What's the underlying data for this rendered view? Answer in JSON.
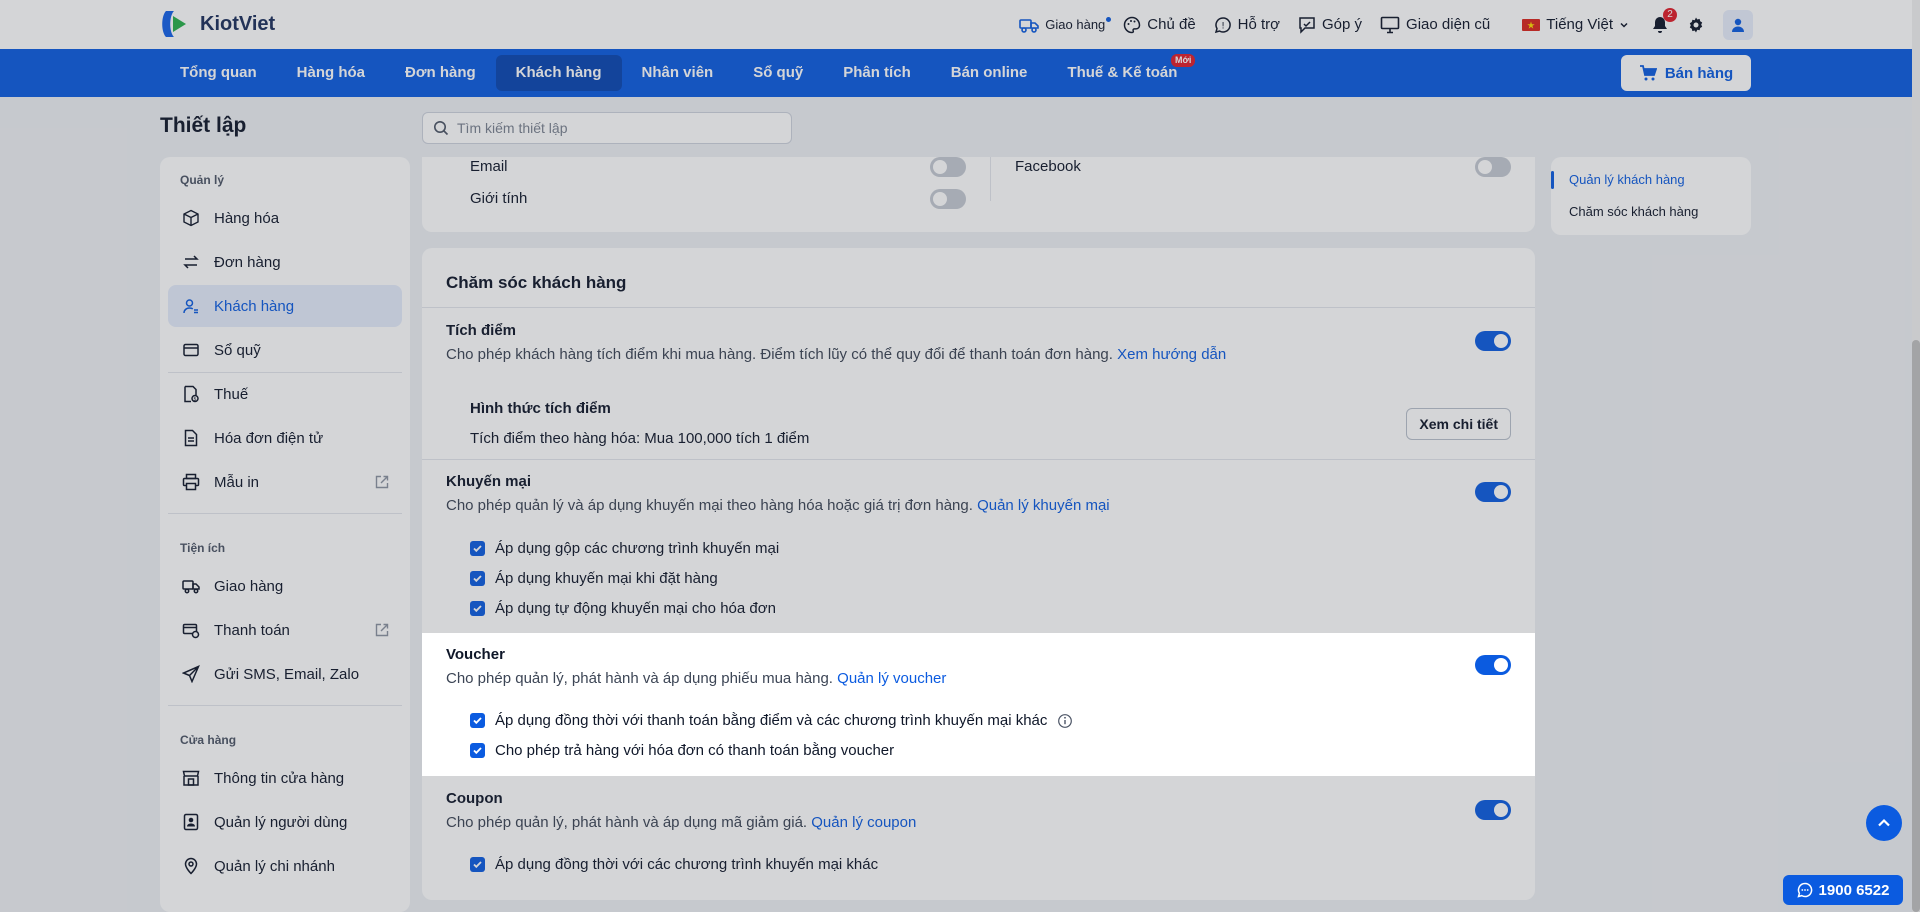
{
  "app": {
    "name": "KiotViet"
  },
  "topbar": {
    "shipping": "Giao hàng",
    "theme": "Chủ đề",
    "support": "Hỗ trợ",
    "feedback": "Góp ý",
    "old_ui": "Giao diện cũ",
    "language": "Tiếng Việt",
    "notification_count": "2"
  },
  "nav": {
    "items": [
      "Tổng quan",
      "Hàng hóa",
      "Đơn hàng",
      "Khách hàng",
      "Nhân viên",
      "Sổ quỹ",
      "Phân tích",
      "Bán online",
      "Thuế & Kế toán"
    ],
    "new_badge": "Mới",
    "sell_button": "Bán hàng"
  },
  "page": {
    "title": "Thiết lập",
    "search_placeholder": "Tìm kiếm thiết lập"
  },
  "sidebar": {
    "section_manage": "Quản lý",
    "products": "Hàng hóa",
    "orders": "Đơn hàng",
    "customers": "Khách hàng",
    "cashbook": "Sổ quỹ",
    "tax": "Thuế",
    "einvoice": "Hóa đơn điện tử",
    "print_templates": "Mẫu in",
    "section_utilities": "Tiện ích",
    "delivery": "Giao hàng",
    "payment": "Thanh toán",
    "messaging": "Gửi SMS, Email, Zalo",
    "section_store": "Cửa hàng",
    "store_info": "Thông tin cửa hàng",
    "user_mgmt": "Quản lý người dùng",
    "branch_mgmt": "Quản lý chi nhánh"
  },
  "fields": {
    "email": "Email",
    "gender": "Giới tính",
    "facebook": "Facebook"
  },
  "care": {
    "title": "Chăm sóc khách hàng",
    "points": {
      "title": "Tích điểm",
      "desc": "Cho phép khách hàng tích điểm khi mua hàng. Điểm tích lũy có thể quy đổi để thanh toán đơn hàng.",
      "link": "Xem hướng dẫn",
      "method_title": "Hình thức tích điểm",
      "method_value": "Tích điểm theo hàng hóa: Mua 100,000 tích 1 điểm",
      "detail_button": "Xem chi tiết"
    },
    "promo": {
      "title": "Khuyến mại",
      "desc": "Cho phép quản lý và áp dụng khuyến mại theo hàng hóa hoặc giá trị đơn hàng.",
      "link": "Quản lý khuyến mại",
      "opt1": "Áp dụng gộp các chương trình khuyến mại",
      "opt2": "Áp dụng khuyến mại khi đặt hàng",
      "opt3": "Áp dụng tự động khuyến mại cho hóa đơn"
    },
    "voucher": {
      "title": "Voucher",
      "desc": "Cho phép quản lý, phát hành và áp dụng phiếu mua hàng.",
      "link": "Quản lý voucher",
      "opt1": "Áp dụng đồng thời với thanh toán bằng điểm và các chương trình khuyến mại khác",
      "opt2": "Cho phép trả hàng với hóa đơn có thanh toán bằng voucher"
    },
    "coupon": {
      "title": "Coupon",
      "desc": "Cho phép quản lý, phát hành và áp dụng mã giảm giá.",
      "link": "Quản lý coupon",
      "opt1": "Áp dụng đồng thời với các chương trình khuyến mại khác"
    }
  },
  "toc": {
    "item1": "Quản lý khách hàng",
    "item2": "Chăm sóc khách hàng"
  },
  "hotline": "1900 6522",
  "colors": {
    "primary": "#0b5be0",
    "danger": "#e11d2a"
  }
}
